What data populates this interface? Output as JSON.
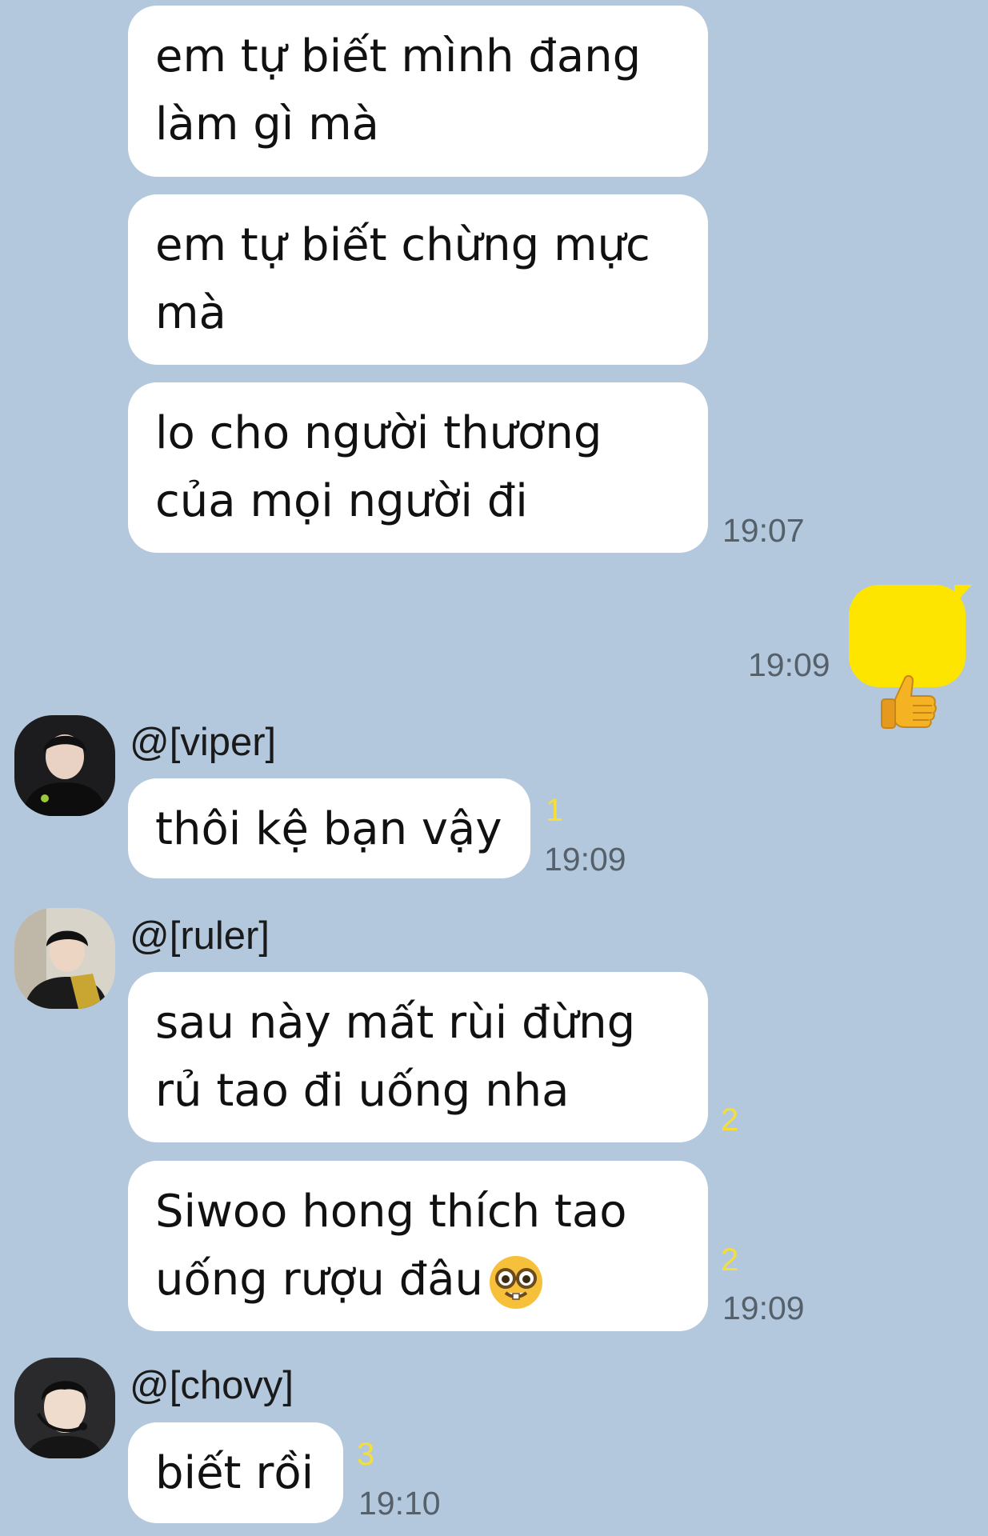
{
  "messages": {
    "m1": {
      "text": "em tự biết mình đang\nlàm gì mà"
    },
    "m2": {
      "text": "em tự biết chừng mực\nmà"
    },
    "m3": {
      "text": "lo cho người thương\ncủa mọi người đi",
      "time": "19:07"
    },
    "m4": {
      "emoji": "thumbs-up",
      "time": "19:09"
    },
    "viper": {
      "sender": "@[viper]",
      "text": "thôi kệ bạn vậy",
      "unread": "1",
      "time": "19:09"
    },
    "ruler1": {
      "sender": "@[ruler]",
      "text": "sau này mất rùi đừng\nrủ tao đi uống nha",
      "unread": "2"
    },
    "ruler2": {
      "line1": "Siwoo hong thích tao",
      "line2": "uống rượu đâu",
      "emoji": "nerd-face",
      "unread": "2",
      "time": "19:09"
    },
    "chovy": {
      "sender": "@[chovy]",
      "text": "biết rồi",
      "unread": "3",
      "time": "19:10"
    }
  },
  "colors": {
    "background": "#b3c8dc",
    "incoming_bubble": "#ffffff",
    "outgoing_bubble": "#fee500",
    "unread": "#f5de3a"
  }
}
